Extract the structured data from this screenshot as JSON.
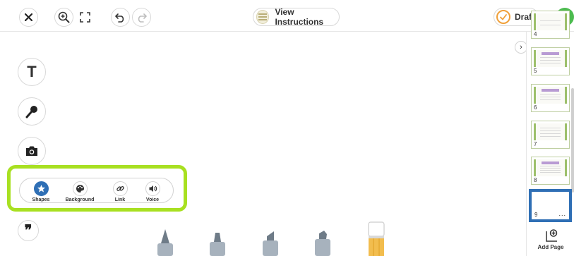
{
  "toolbar": {
    "instructions_label": "View Instructions",
    "draft_label": "Draft"
  },
  "media_bar": {
    "items": [
      {
        "label": "Shapes",
        "icon": "shapes-icon",
        "active": true
      },
      {
        "label": "Background",
        "icon": "palette-icon",
        "active": false
      },
      {
        "label": "Link",
        "icon": "link-icon",
        "active": false
      },
      {
        "label": "Voice",
        "icon": "speaker-icon",
        "active": false
      }
    ]
  },
  "tools": {
    "text_glyph": "T",
    "quote_glyph": "❞"
  },
  "pages": {
    "thumbnails": [
      {
        "number": "4"
      },
      {
        "number": "5"
      },
      {
        "number": "6"
      },
      {
        "number": "7"
      },
      {
        "number": "8"
      },
      {
        "number": "9",
        "more": "..."
      }
    ],
    "add_label": "Add Page"
  },
  "colors": {
    "highlight": "#a8e021",
    "accent_blue": "#2f6fb5",
    "done_green": "#4cbb4f",
    "draft_orange": "#f0a03a"
  }
}
